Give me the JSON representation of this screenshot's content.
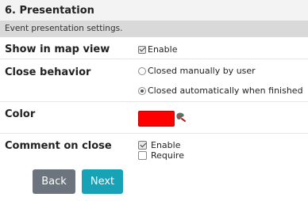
{
  "header": {
    "title": "6. Presentation",
    "subtitle": "Event presentation settings."
  },
  "fields": {
    "show_in_map_view": {
      "label": "Show in map view",
      "option_label": "Enable",
      "checked": true
    },
    "close_behavior": {
      "label": "Close behavior",
      "options": [
        {
          "label": "Closed manually by user",
          "selected": false
        },
        {
          "label": "Closed automatically when finished",
          "selected": true
        }
      ]
    },
    "color": {
      "label": "Color",
      "value": "#ff0000",
      "picker_icon": "color-picker-icon"
    },
    "comment_on_close": {
      "label": "Comment on close",
      "options": [
        {
          "label": "Enable",
          "checked": true
        },
        {
          "label": "Require",
          "checked": false
        }
      ]
    }
  },
  "buttons": {
    "back": {
      "label": "Back",
      "color": "#6c757d"
    },
    "next": {
      "label": "Next",
      "color": "#17a2b8"
    }
  },
  "colors": {
    "title_bg": "#f3f3f3",
    "subtitle_bg": "#d9d9d9"
  }
}
